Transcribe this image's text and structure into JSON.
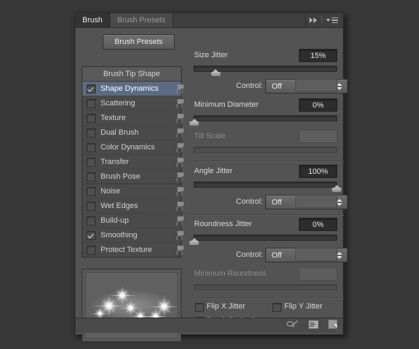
{
  "panel": {
    "tabs": [
      {
        "label": "Brush",
        "active": true
      },
      {
        "label": "Brush Presets",
        "active": false
      }
    ],
    "header_icons": [
      "double-chevron-right-icon",
      "panel-menu-icon"
    ],
    "preset_button": "Brush Presets"
  },
  "brush_list": {
    "heading": "Brush Tip Shape",
    "items": [
      {
        "label": "Shape Dynamics",
        "checked": true,
        "selected": true,
        "lock": "unlocked-icon",
        "group_end": false
      },
      {
        "label": "Scattering",
        "checked": false,
        "selected": false,
        "lock": "unlocked-icon",
        "group_end": false
      },
      {
        "label": "Texture",
        "checked": false,
        "selected": false,
        "lock": "unlocked-icon",
        "group_end": false
      },
      {
        "label": "Dual Brush",
        "checked": false,
        "selected": false,
        "lock": "unlocked-icon",
        "group_end": false
      },
      {
        "label": "Color Dynamics",
        "checked": false,
        "selected": false,
        "lock": "unlocked-icon",
        "group_end": false
      },
      {
        "label": "Transfer",
        "checked": false,
        "selected": false,
        "lock": "unlocked-icon",
        "group_end": false
      },
      {
        "label": "Brush Pose",
        "checked": false,
        "selected": false,
        "lock": "unlocked-icon",
        "group_end": true
      },
      {
        "label": "Noise",
        "checked": false,
        "selected": false,
        "lock": "unlocked-icon",
        "group_end": false
      },
      {
        "label": "Wet Edges",
        "checked": false,
        "selected": false,
        "lock": "unlocked-icon",
        "group_end": false
      },
      {
        "label": "Build-up",
        "checked": false,
        "selected": false,
        "lock": "unlocked-icon",
        "group_end": false
      },
      {
        "label": "Smoothing",
        "checked": true,
        "selected": false,
        "lock": "unlocked-icon",
        "group_end": false
      },
      {
        "label": "Protect Texture",
        "checked": false,
        "selected": false,
        "lock": "unlocked-icon",
        "group_end": false
      }
    ]
  },
  "preview": {
    "name": "brush-stroke-preview"
  },
  "settings": {
    "size_jitter": {
      "label": "Size Jitter",
      "value": "15%",
      "percent": 15,
      "disabled": false
    },
    "size_control": {
      "label": "Control:",
      "value": "Off",
      "disabled": false
    },
    "minimum_diameter": {
      "label": "Minimum Diameter",
      "value": "0%",
      "percent": 0,
      "disabled": false
    },
    "tilt_scale": {
      "label": "Tilt Scale",
      "value": "",
      "percent": 0,
      "disabled": true
    },
    "angle_jitter": {
      "label": "Angle Jitter",
      "value": "100%",
      "percent": 100,
      "disabled": false
    },
    "angle_control": {
      "label": "Control:",
      "value": "Off",
      "disabled": false
    },
    "roundness_jitter": {
      "label": "Roundness Jitter",
      "value": "0%",
      "percent": 0,
      "disabled": false
    },
    "roundness_control": {
      "label": "Control:",
      "value": "Off",
      "disabled": false
    },
    "minimum_roundness": {
      "label": "Minimum Roundness",
      "value": "",
      "percent": 0,
      "disabled": true
    }
  },
  "checkboxes": [
    {
      "label": "Flip X Jitter",
      "checked": false
    },
    {
      "label": "Flip Y Jitter",
      "checked": false
    },
    {
      "label": "Brush Projection",
      "checked": false
    }
  ],
  "footer_icons": [
    "brush-tool-icon",
    "toggle-panel-icon",
    "new-brush-icon",
    "resize-grip-icon"
  ],
  "colors": {
    "panel_bg": "#535353",
    "selection": "#5b6b84",
    "value_box": "#2d2d2d",
    "text": "#d9d9d9",
    "text_disabled": "#8d8d8d"
  }
}
